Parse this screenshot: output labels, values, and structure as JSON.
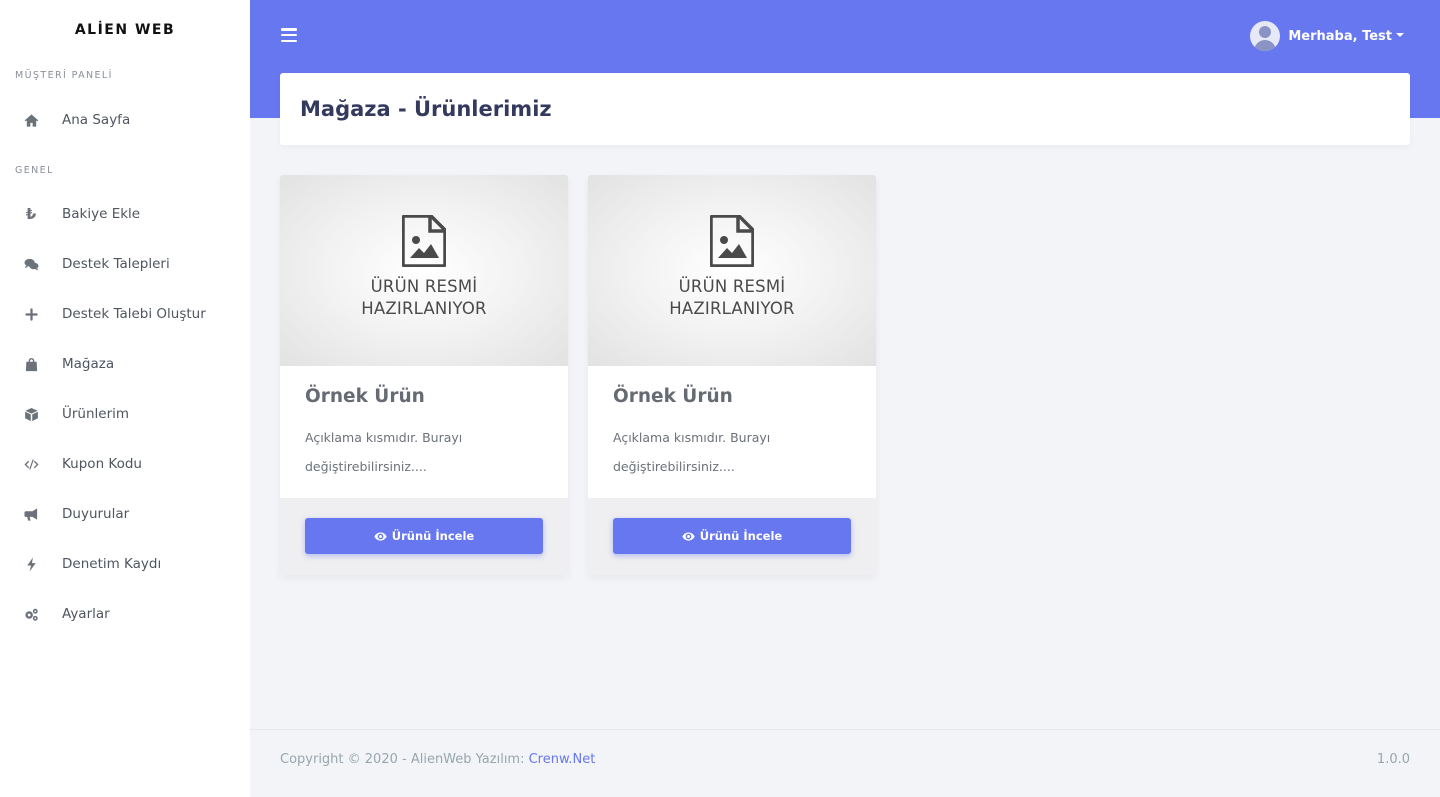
{
  "brand": "ALİEN WEB",
  "sidebar": {
    "section1_title": "MÜŞTERİ PANELİ",
    "section2_title": "GENEL",
    "items": [
      {
        "label": "Ana Sayfa",
        "icon": "home-icon"
      },
      {
        "label": "Bakiye Ekle",
        "icon": "lira-icon"
      },
      {
        "label": "Destek Talepleri",
        "icon": "comments-icon"
      },
      {
        "label": "Destek Talebi Oluştur",
        "icon": "plus-icon"
      },
      {
        "label": "Mağaza",
        "icon": "shopping-bag-icon"
      },
      {
        "label": "Ürünlerim",
        "icon": "box-icon"
      },
      {
        "label": "Kupon Kodu",
        "icon": "code-icon"
      },
      {
        "label": "Duyurular",
        "icon": "bullhorn-icon"
      },
      {
        "label": "Denetim Kaydı",
        "icon": "bolt-icon"
      },
      {
        "label": "Ayarlar",
        "icon": "cogs-icon"
      }
    ]
  },
  "topbar": {
    "user_greeting": "Merhaba, Test"
  },
  "page": {
    "title": "Mağaza - Ürünlerimiz"
  },
  "products": [
    {
      "image_text_line1": "ÜRÜN RESMİ",
      "image_text_line2": "HAZIRLANIYOR",
      "title": "Örnek Ürün",
      "desc_line1": "Açıklama kısmıdır. Burayı",
      "desc_line2": "değiştirebilirsiniz....",
      "button": "Ürünü İncele"
    },
    {
      "image_text_line1": "ÜRÜN RESMİ",
      "image_text_line2": "HAZIRLANIYOR",
      "title": "Örnek Ürün",
      "desc_line1": "Açıklama kısmıdır. Burayı",
      "desc_line2": "değiştirebilirsiniz....",
      "button": "Ürünü İncele"
    }
  ],
  "footer": {
    "copyright": "Copyright © 2020 - AlienWeb Yazılım: ",
    "link": "Crenw.Net",
    "version": "1.0.0"
  },
  "colors": {
    "accent": "#6777ef",
    "background": "#f3f4f8"
  }
}
